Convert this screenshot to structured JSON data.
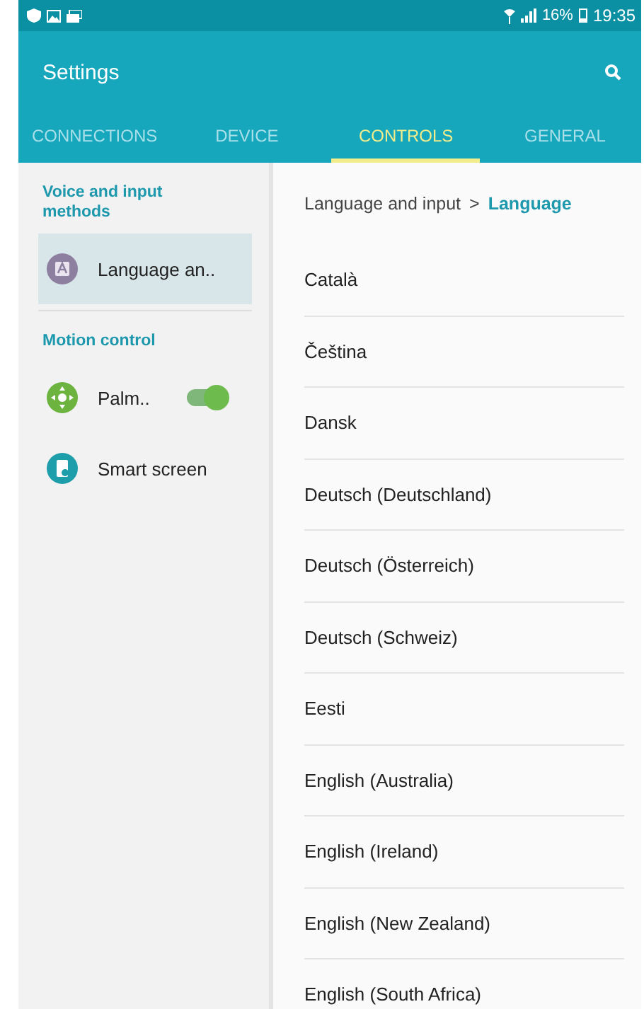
{
  "status_bar": {
    "battery": "16%",
    "time": "19:35"
  },
  "app_bar": {
    "title": "Settings"
  },
  "tabs": [
    {
      "label": "CONNECTIONS",
      "selected": false
    },
    {
      "label": "DEVICE",
      "selected": false
    },
    {
      "label": "CONTROLS",
      "selected": true
    },
    {
      "label": "GENERAL",
      "selected": false
    }
  ],
  "sidebar": {
    "sections": [
      {
        "title": "Voice and input methods",
        "items": [
          {
            "label": "Language an..",
            "selected": true
          }
        ]
      },
      {
        "title": "Motion control",
        "items": [
          {
            "label": "Palm..",
            "selected": false,
            "switch_on": true
          },
          {
            "label": "Smart screen",
            "selected": false
          }
        ]
      }
    ]
  },
  "breadcrumb": {
    "parent": "Language and input",
    "separator": ">",
    "current": "Language"
  },
  "languages": [
    "Català",
    "Čeština",
    "Dansk",
    "Deutsch (Deutschland)",
    "Deutsch (Österreich)",
    "Deutsch (Schweiz)",
    "Eesti",
    "English (Australia)",
    "English (Ireland)",
    "English (New Zealand)",
    "English (South Africa)"
  ]
}
